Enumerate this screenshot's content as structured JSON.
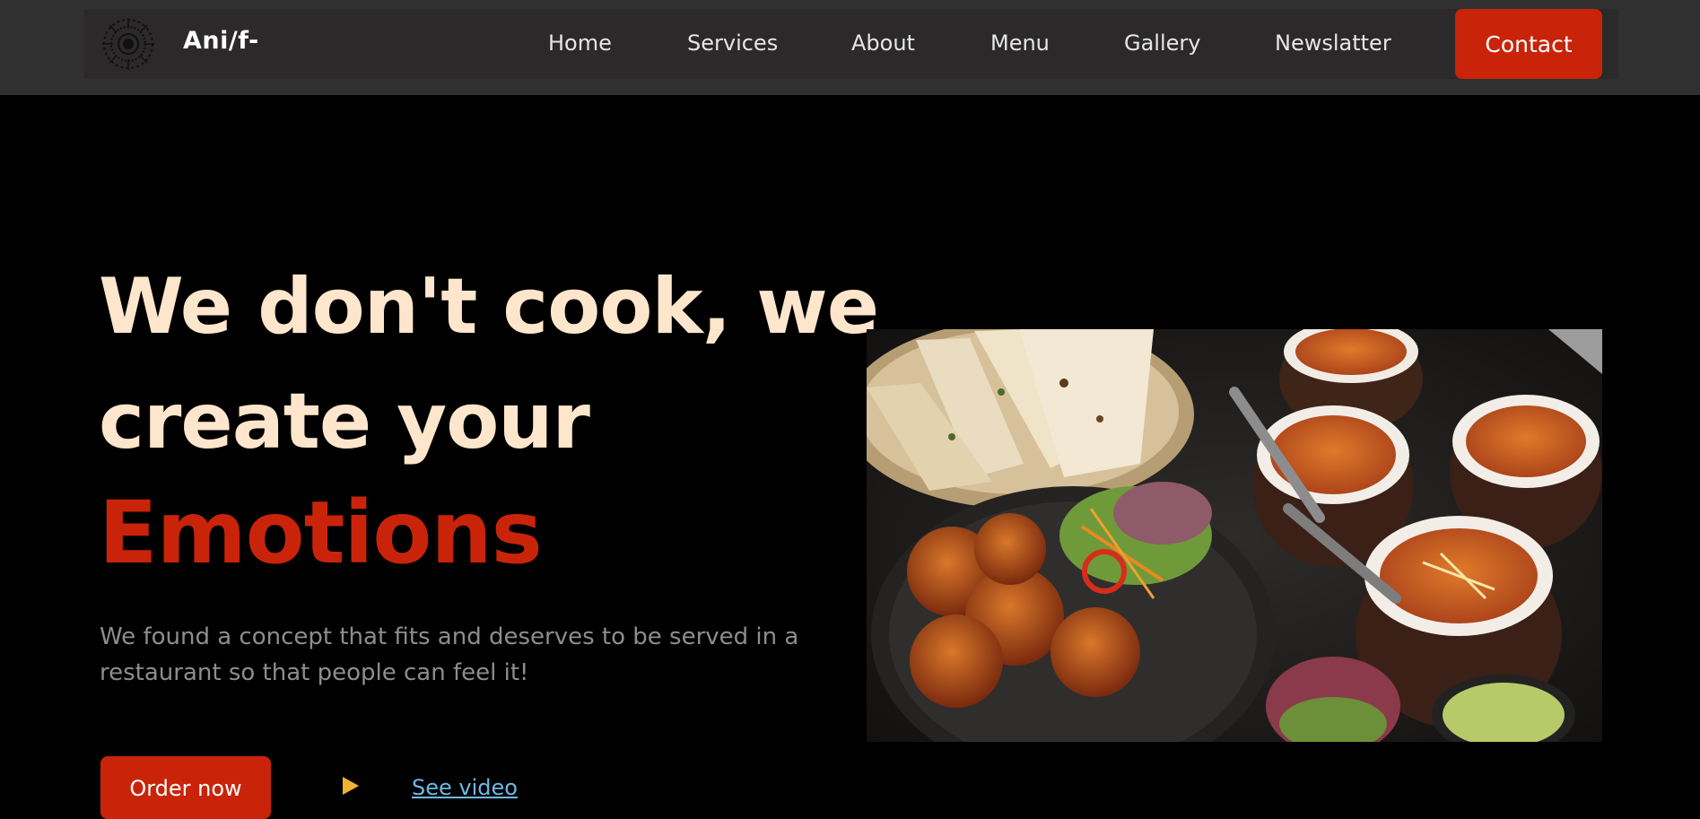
{
  "nav": {
    "brand": "Ani/f-",
    "links": [
      "Home",
      "Services",
      "About",
      "Menu",
      "Gallery",
      "Newslatter"
    ],
    "contact_label": "Contact"
  },
  "hero": {
    "title_line1": "We don't cook, we",
    "title_line2": "create your",
    "title_accent": "Emotions",
    "subtitle": "We found a concept that fits and deserves to be served in a restaurant so that people can feel it!",
    "order_label": "Order now",
    "video_label": "See video"
  },
  "colors": {
    "accent": "#c9240a",
    "title": "#fde6cc",
    "nav_bg": "#2b292a",
    "video_link": "#6fb8e4",
    "play": "#f2b233"
  },
  "icons": {
    "logo": "mandala-logo-icon",
    "play": "play-icon"
  }
}
